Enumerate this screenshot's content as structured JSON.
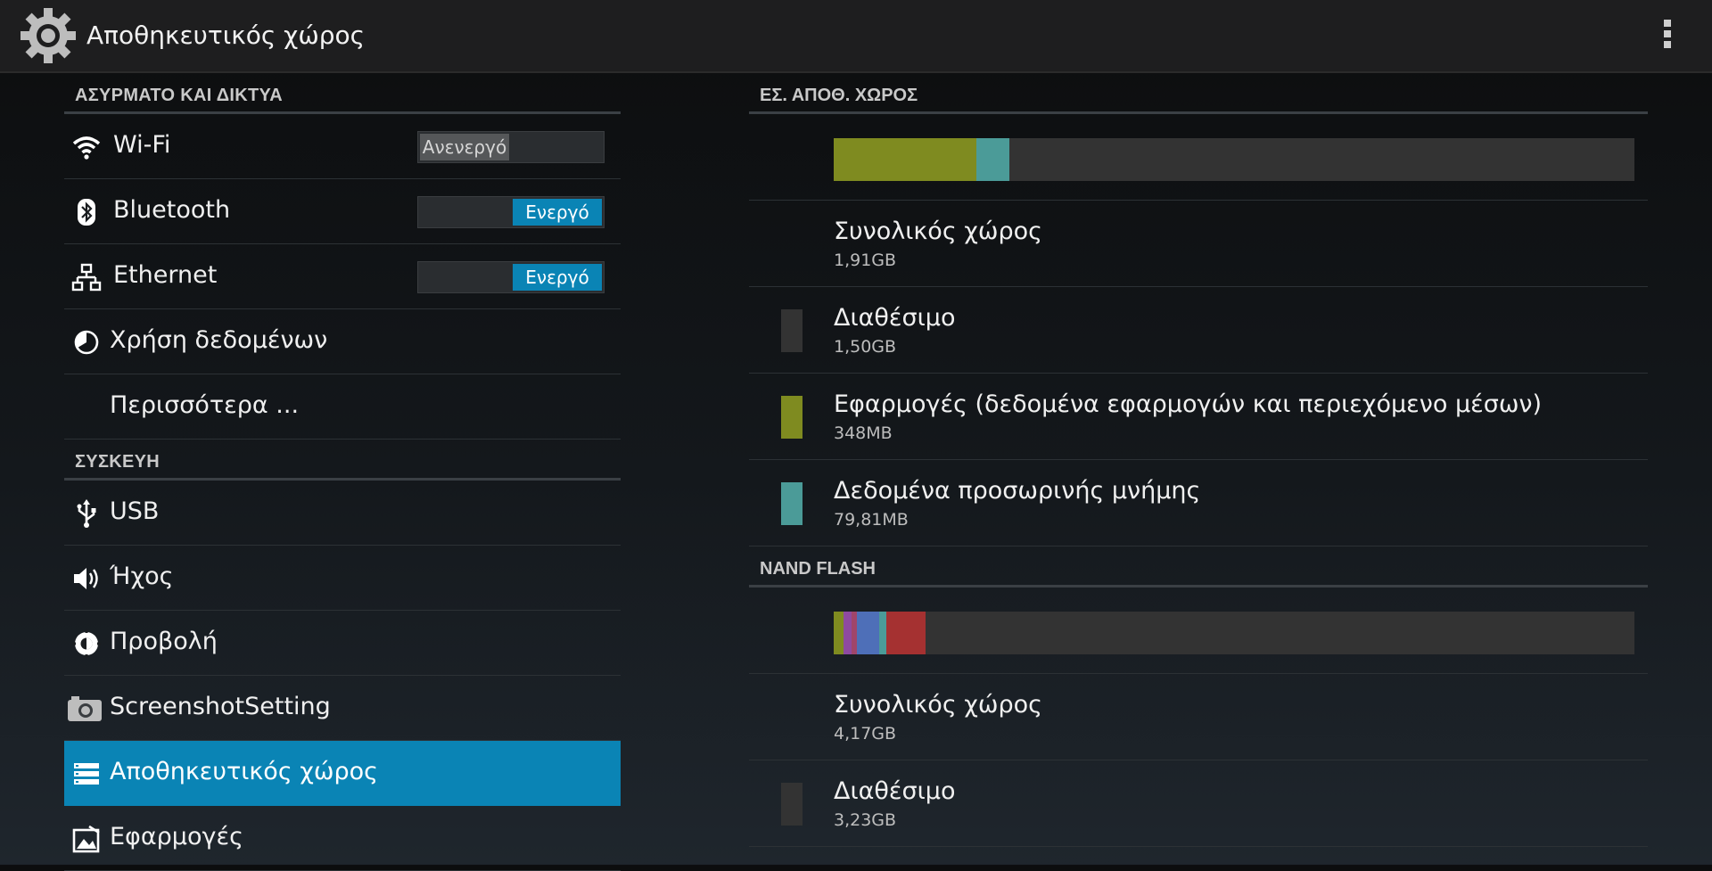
{
  "actionbar": {
    "title": "Αποθηκευτικός χώρος",
    "icon": "gear-icon",
    "overflow_icon": "overflow-menu-icon"
  },
  "left": {
    "sections": [
      {
        "header": "ΑΣΥΡΜΑΤΟ ΚΑΙ ΔΙΚΤΥΑ",
        "items": [
          {
            "icon": "wifi-icon",
            "label": "Wi-Fi",
            "toggle": "off",
            "toggle_label": "Ανενεργό"
          },
          {
            "icon": "bluetooth-icon",
            "label": "Bluetooth",
            "toggle": "on",
            "toggle_label": "Ενεργό"
          },
          {
            "icon": "ethernet-icon",
            "label": "Ethernet",
            "toggle": "on",
            "toggle_label": "Ενεργό"
          },
          {
            "icon": "data-usage-icon",
            "label": "Χρήση δεδομένων"
          },
          {
            "icon": "",
            "label": "Περισσότερα ..."
          }
        ]
      },
      {
        "header": "ΣΥΣΚΕΥΗ",
        "items": [
          {
            "icon": "usb-icon",
            "label": "USB"
          },
          {
            "icon": "sound-icon",
            "label": "Ήχος"
          },
          {
            "icon": "display-icon",
            "label": "Προβολή"
          },
          {
            "icon": "camera-icon",
            "label": "ScreenshotSetting"
          },
          {
            "icon": "storage-icon",
            "label": "Αποθηκευτικός χώρος",
            "selected": true
          },
          {
            "icon": "apps-icon",
            "label": "Εφαρμογές"
          }
        ]
      }
    ]
  },
  "right": {
    "sections": [
      {
        "header": "ΕΣ. ΑΠΟΘ. ΧΩΡΟΣ",
        "usage_bar": [
          {
            "fraction": 0.178,
            "color": "#7f8b20"
          },
          {
            "fraction": 0.041,
            "color": "#4b9b98"
          }
        ],
        "rows": [
          {
            "title": "Συνολικός χώρος",
            "value": "1,91GB",
            "color": ""
          },
          {
            "title": "Διαθέσιμο",
            "value": "1,50GB",
            "color": "#333333"
          },
          {
            "title": "Εφαρμογές (δεδομένα εφαρμογών και περιεχόμενο μέσων)",
            "value": "348MB",
            "color": "#7f8b20"
          },
          {
            "title": "Δεδομένα προσωρινής μνήμης",
            "value": "79,81MB",
            "color": "#4b9b98"
          }
        ]
      },
      {
        "header": "NAND FLASH",
        "usage_bar": [
          {
            "fraction": 0.012,
            "color": "#7f8b20"
          },
          {
            "fraction": 0.01,
            "color": "#8e4aa0"
          },
          {
            "fraction": 0.007,
            "color": "#a0456a"
          },
          {
            "fraction": 0.028,
            "color": "#4e6fb8"
          },
          {
            "fraction": 0.009,
            "color": "#4b9b98"
          },
          {
            "fraction": 0.049,
            "color": "#a53131"
          }
        ],
        "rows": [
          {
            "title": "Συνολικός χώρος",
            "value": "4,17GB",
            "color": ""
          },
          {
            "title": "Διαθέσιμο",
            "value": "3,23GB",
            "color": "#333333"
          }
        ]
      }
    ]
  }
}
